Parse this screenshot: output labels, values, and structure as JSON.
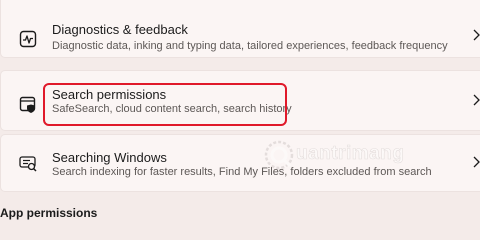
{
  "settings_list": [
    {
      "id": "diagnostics",
      "icon": "diagnostics-pulse-icon",
      "title": "Diagnostics & feedback",
      "description": "Diagnostic data, inking and typing data, tailored experiences, feedback frequency"
    },
    {
      "id": "search-permissions",
      "icon": "search-permissions-shield-icon",
      "title": "Search permissions",
      "description": "SafeSearch, cloud content search, search history",
      "highlighted": true,
      "highlight_color": "#e0192a"
    },
    {
      "id": "searching-windows",
      "icon": "search-list-icon",
      "title": "Searching Windows",
      "description": "Search indexing for faster results, Find My Files, folders excluded from search"
    }
  ],
  "section_heading": "App permissions",
  "watermark": {
    "text": "uantrimang"
  },
  "colors": {
    "background": "#f4ebe9",
    "card": "#fbf5f4",
    "highlight": "#e0192a"
  }
}
